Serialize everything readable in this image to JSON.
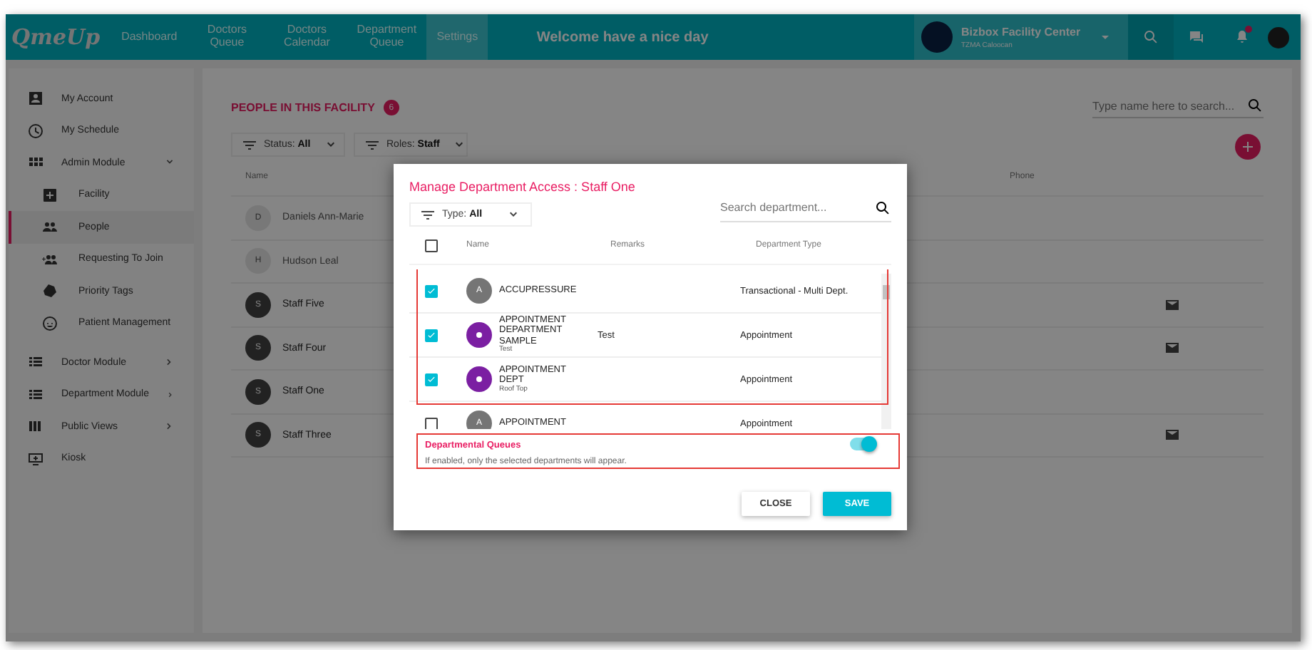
{
  "topbar": {
    "logo": "QmeUp",
    "nav": [
      {
        "label": "Dashboard",
        "selected": false
      },
      {
        "label": "Doctors Queue",
        "selected": false
      },
      {
        "label": "Doctors Calendar",
        "selected": false
      },
      {
        "label": "Department Queue",
        "selected": false
      },
      {
        "label": "Settings",
        "selected": true
      }
    ],
    "welcome": "Welcome have a nice day",
    "facility": {
      "name": "Bizbox Facility Center",
      "location": "TZMA Caloocan"
    },
    "notifications_dot": true
  },
  "sidebar": {
    "items": [
      {
        "label": "My Account",
        "selected": false
      },
      {
        "label": "My Schedule",
        "selected": false
      },
      {
        "label": "Admin Module",
        "selected": false,
        "expanded": true,
        "children": [
          {
            "label": "Facility",
            "selected": false
          },
          {
            "label": "People",
            "selected": true
          },
          {
            "label": "Requesting To Join",
            "selected": false
          },
          {
            "label": "Priority Tags",
            "selected": false
          },
          {
            "label": "Patient Management",
            "selected": false
          }
        ]
      },
      {
        "label": "Doctor Module",
        "selected": false,
        "expanded": false
      },
      {
        "label": "Department Module",
        "selected": false,
        "expanded": false
      },
      {
        "label": "Public Views",
        "selected": false,
        "expanded": false
      },
      {
        "label": "Kiosk",
        "selected": false
      }
    ]
  },
  "people": {
    "title": "PEOPLE IN THIS FACILITY",
    "count": "6",
    "search": {
      "placeholder": "Type name here to search..."
    },
    "filters": [
      {
        "label": "Status:",
        "value": "All"
      },
      {
        "label": "Roles:",
        "value": "Staff"
      }
    ],
    "columns": [
      "Name",
      "Phone"
    ],
    "rows": [
      {
        "initial": "D",
        "name": "Daniels Ann-Marie",
        "active": false,
        "email": false
      },
      {
        "initial": "H",
        "name": "Hudson Leal",
        "active": false,
        "email": false
      },
      {
        "initial": "S",
        "name": "Staff Five",
        "active": true,
        "email": true
      },
      {
        "initial": "S",
        "name": "Staff Four",
        "active": true,
        "email": true
      },
      {
        "initial": "S",
        "name": "Staff One",
        "active": true,
        "email": false
      },
      {
        "initial": "S",
        "name": "Staff Three",
        "active": true,
        "email": true
      }
    ]
  },
  "dialog": {
    "title": "Manage Department Access : Staff One",
    "filter": {
      "label": "Type:",
      "value": "All"
    },
    "search": {
      "placeholder": "Search department..."
    },
    "select_all_checked": false,
    "columns": [
      "Name",
      "Remarks",
      "Department Type"
    ],
    "departments": [
      {
        "kind": "letter",
        "initial": "A",
        "color": "#757575",
        "name": "ACCUPRESSURE",
        "type": "Transactional - Multi Dept.",
        "checked": true
      },
      {
        "kind": "image",
        "color": "#7b1fa2",
        "name": "APPOINTMENT DEPARTMENT SAMPLE",
        "location": "Test",
        "remarks": "Test",
        "type": "Appointment",
        "checked": true
      },
      {
        "kind": "image",
        "color": "#7b1fa2",
        "name": "APPOINTMENT DEPT",
        "location": "Roof Top",
        "type": "Appointment",
        "checked": true
      },
      {
        "kind": "letter",
        "initial": "A",
        "color": "#757575",
        "name": "APPOINTMENT",
        "type": "Appointment",
        "checked": false
      }
    ],
    "queues": {
      "title": "Departmental Queues",
      "hint": "If enabled, only the selected departments will appear.",
      "on": true
    },
    "buttons": [
      {
        "label": "CLOSE",
        "kind": "secondary"
      },
      {
        "label": "SAVE",
        "kind": "primary"
      }
    ]
  }
}
